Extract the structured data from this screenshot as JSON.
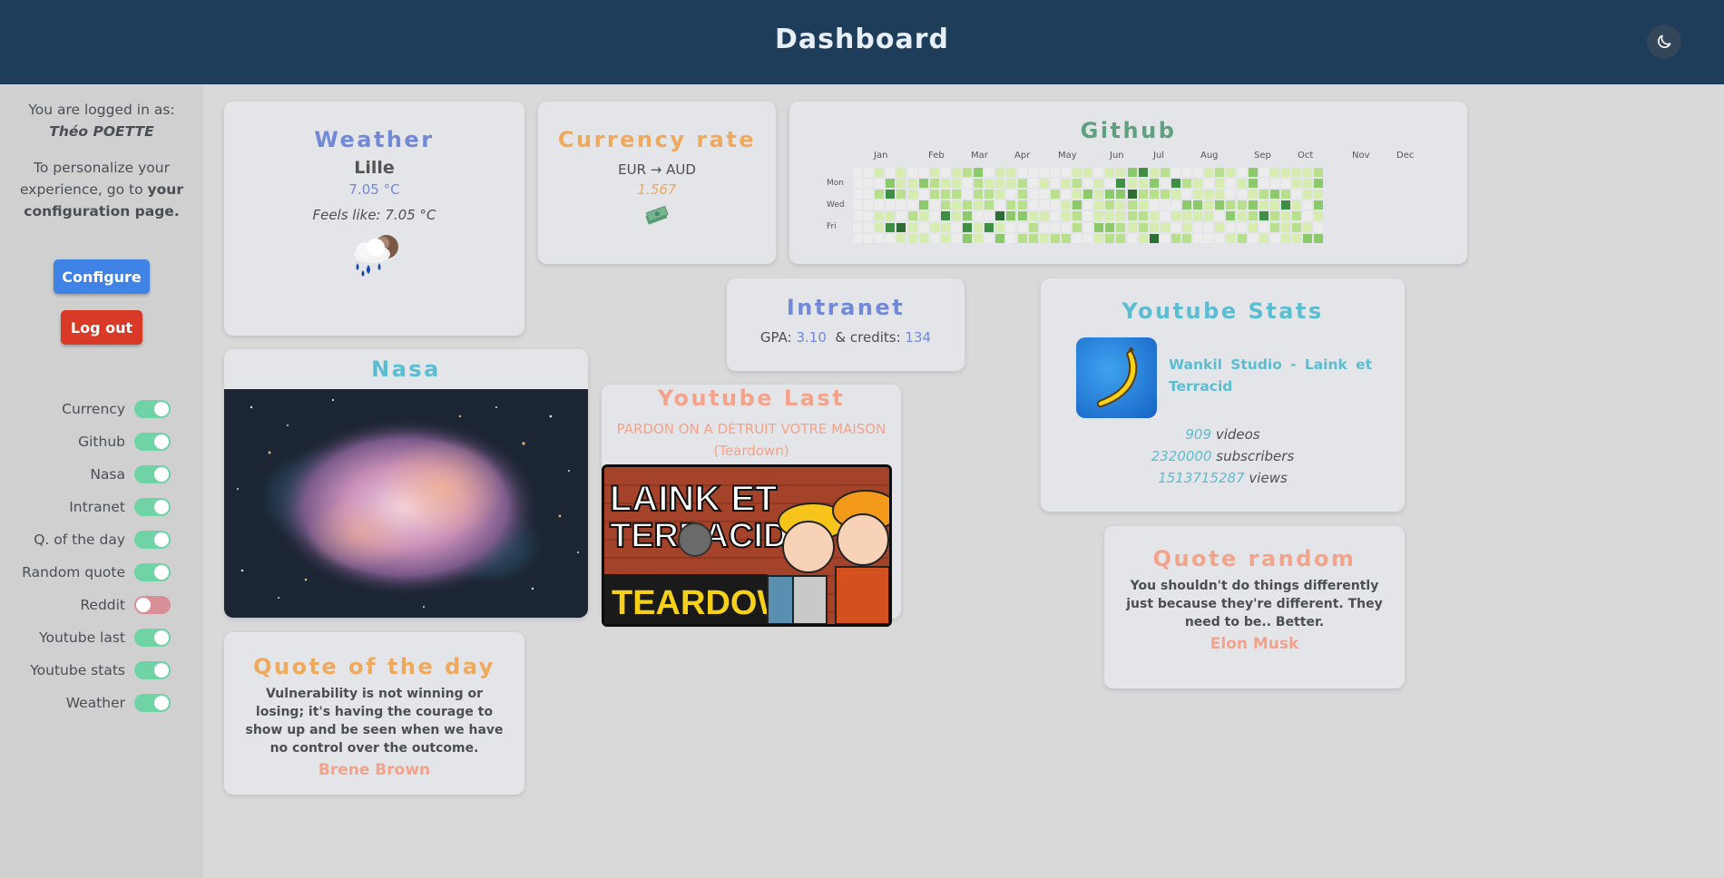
{
  "header": {
    "title": "Dashboard",
    "theme_icon": "moon-icon"
  },
  "sidebar": {
    "logged_in_text": "You are logged in as:",
    "username": "Théo POETTE",
    "personalize_text": "To personalize your experience, go to",
    "config_link_text": "your configuration page.",
    "configure_label": "Configure",
    "logout_label": "Log out",
    "toggles": [
      {
        "label": "Currency",
        "on": true
      },
      {
        "label": "Github",
        "on": true
      },
      {
        "label": "Nasa",
        "on": true
      },
      {
        "label": "Intranet",
        "on": true
      },
      {
        "label": "Q. of the day",
        "on": true
      },
      {
        "label": "Random quote",
        "on": true
      },
      {
        "label": "Reddit",
        "on": false
      },
      {
        "label": "Youtube last",
        "on": true
      },
      {
        "label": "Youtube stats",
        "on": true
      },
      {
        "label": "Weather",
        "on": true
      }
    ]
  },
  "weather": {
    "title": "Weather",
    "city": "Lille",
    "temp": "7.05 °C",
    "feels": "Feels like: 7.05 °C",
    "icon": "rain-cloud-icon"
  },
  "currency": {
    "title": "Currency rate",
    "pair": "EUR → AUD",
    "rate": "1.567",
    "icon": "money-icon"
  },
  "github": {
    "title": "Github",
    "months": [
      "Jan",
      "Feb",
      "Mar",
      "Apr",
      "May",
      "Jun",
      "Jul",
      "Aug",
      "Sep",
      "Oct",
      "Nov",
      "Dec"
    ],
    "days": [
      "Mon",
      "Wed",
      "Fri"
    ]
  },
  "intranet": {
    "title": "Intranet",
    "gpa_label": "GPA:",
    "gpa": "3.10",
    "credits_label": "& credits:",
    "credits": "134"
  },
  "ytstats": {
    "title": "Youtube Stats",
    "channel": "Wankil Studio - Laink et Terracid",
    "videos": "909",
    "videos_label": "videos",
    "subscribers": "2320000",
    "subscribers_label": "subscribers",
    "views": "1513715287",
    "views_label": "views"
  },
  "nasa": {
    "title": "Nasa"
  },
  "ytlast": {
    "title": "Youtube Last",
    "video_title": "PARDON ON A DÉTRUIT VOTRE MAISON (Teardown)",
    "thumb_text_1": "LAINK ET",
    "thumb_text_2": "TERRACID",
    "thumb_text_3": "TEARDOWN"
  },
  "quote_day": {
    "title": "Quote of the day",
    "quote": "Vulnerability is not winning or losing; it's having the courage to show up and be seen when we have no control over the outcome.",
    "author": "Brene Brown"
  },
  "quote_random": {
    "title": "Quote random",
    "quote": "You shouldn't do things differently just because they're different. They need to be.. Better.",
    "author": "Elon Musk"
  }
}
